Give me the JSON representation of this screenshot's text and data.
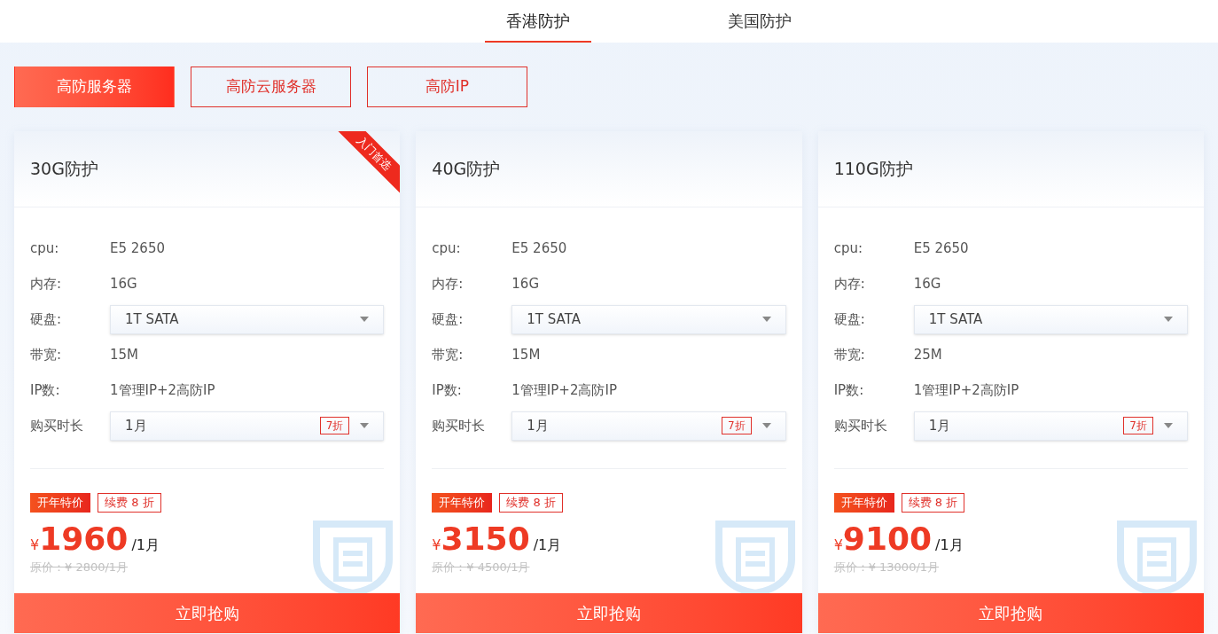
{
  "region_tabs": [
    {
      "label": "香港防护",
      "selected": true
    },
    {
      "label": "美国防护",
      "selected": false
    }
  ],
  "categories": [
    {
      "label": "高防服务器",
      "selected": true
    },
    {
      "label": "高防云服务器",
      "selected": false
    },
    {
      "label": "高防IP",
      "selected": false
    }
  ],
  "plans": [
    {
      "title": "30G防护",
      "ribbon": "入门首选",
      "specs": [
        {
          "kind": "text",
          "label": "cpu:",
          "value": "E5 2650"
        },
        {
          "kind": "text",
          "label": "内存:",
          "value": "16G"
        },
        {
          "kind": "select",
          "label": "硬盘:",
          "value": "1T SATA"
        },
        {
          "kind": "text",
          "label": "带宽:",
          "value": "15M"
        },
        {
          "kind": "text",
          "label": "IP数:",
          "value": "1管理IP+2高防IP"
        },
        {
          "kind": "select",
          "label": "购买时长",
          "value": "1月",
          "discount": "7折"
        }
      ],
      "tags": [
        {
          "kind": "solid",
          "label": "开年特价"
        },
        {
          "kind": "outline",
          "label": "续费 8 折"
        }
      ],
      "currency": "¥",
      "price": "1960",
      "unit": "/1月",
      "original_price": "原价：¥ 2800/1月",
      "button": "立即抢购"
    },
    {
      "title": "40G防护",
      "specs": [
        {
          "kind": "text",
          "label": "cpu:",
          "value": "E5 2650"
        },
        {
          "kind": "text",
          "label": "内存:",
          "value": "16G"
        },
        {
          "kind": "select",
          "label": "硬盘:",
          "value": "1T SATA"
        },
        {
          "kind": "text",
          "label": "带宽:",
          "value": "15M"
        },
        {
          "kind": "text",
          "label": "IP数:",
          "value": "1管理IP+2高防IP"
        },
        {
          "kind": "select",
          "label": "购买时长",
          "value": "1月",
          "discount": "7折"
        }
      ],
      "tags": [
        {
          "kind": "solid",
          "label": "开年特价"
        },
        {
          "kind": "outline",
          "label": "续费 8 折"
        }
      ],
      "currency": "¥",
      "price": "3150",
      "unit": "/1月",
      "original_price": "原价：¥ 4500/1月",
      "button": "立即抢购"
    },
    {
      "title": "110G防护",
      "specs": [
        {
          "kind": "text",
          "label": "cpu:",
          "value": "E5 2650"
        },
        {
          "kind": "text",
          "label": "内存:",
          "value": "16G"
        },
        {
          "kind": "select",
          "label": "硬盘:",
          "value": "1T SATA"
        },
        {
          "kind": "text",
          "label": "带宽:",
          "value": "25M"
        },
        {
          "kind": "text",
          "label": "IP数:",
          "value": "1管理IP+2高防IP"
        },
        {
          "kind": "select",
          "label": "购买时长",
          "value": "1月",
          "discount": "7折"
        }
      ],
      "tags": [
        {
          "kind": "solid",
          "label": "开年特价"
        },
        {
          "kind": "outline",
          "label": "续费 8 折"
        }
      ],
      "currency": "¥",
      "price": "9100",
      "unit": "/1月",
      "original_price": "原价：¥ 13000/1月",
      "button": "立即抢购"
    }
  ]
}
